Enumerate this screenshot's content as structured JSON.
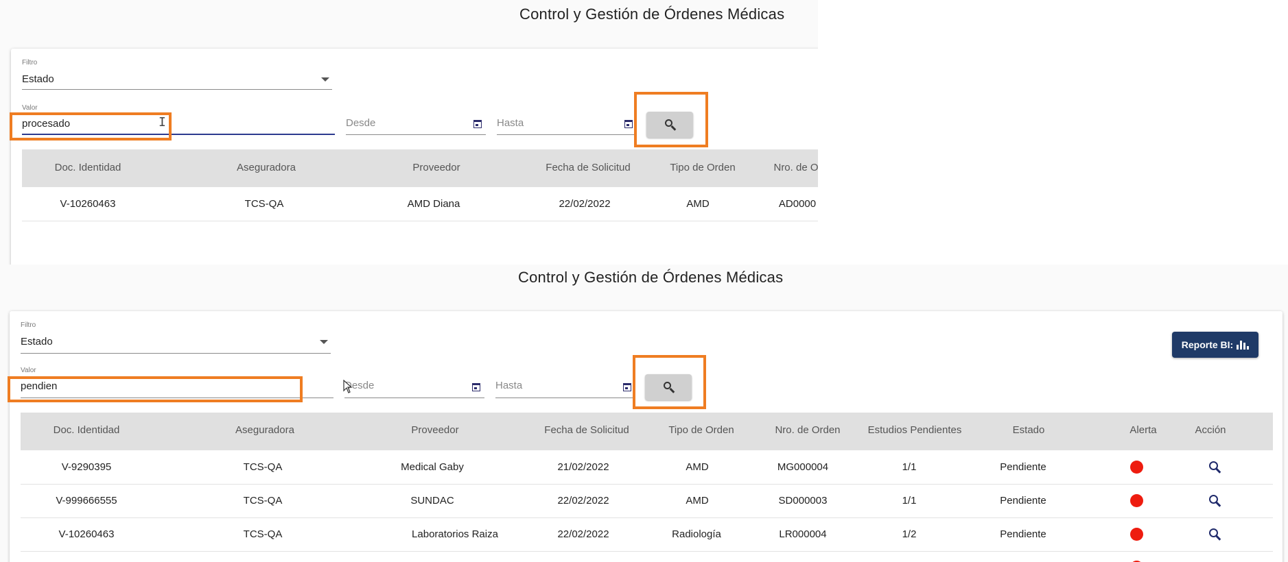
{
  "top": {
    "title": "Control y Gestión de Órdenes Médicas",
    "filter": {
      "label": "Filtro",
      "value": "Estado"
    },
    "value_field": {
      "label": "Valor",
      "value": "procesado"
    },
    "desde": {
      "placeholder": "Desde"
    },
    "hasta": {
      "placeholder": "Hasta"
    },
    "table": {
      "headers": [
        "Doc. Identidad",
        "Aseguradora",
        "Proveedor",
        "Fecha de Solicitud",
        "Tipo de Orden",
        "Nro. de O"
      ],
      "rows": [
        [
          "V-10260463",
          "TCS-QA",
          "AMD Diana",
          "22/02/2022",
          "AMD",
          "AD0000"
        ]
      ]
    }
  },
  "bottom": {
    "title": "Control y Gestión de Órdenes Médicas",
    "filter": {
      "label": "Filtro",
      "value": "Estado"
    },
    "value_field": {
      "label": "Valor",
      "value": "pendien"
    },
    "desde": {
      "placeholder": "Desde"
    },
    "hasta": {
      "placeholder": "Hasta"
    },
    "report_button": {
      "label": "Reporte BI:",
      "icon": "bar-chart-icon"
    },
    "table": {
      "headers": [
        "Doc. Identidad",
        "Aseguradora",
        "Proveedor",
        "Fecha de Solicitud",
        "Tipo de Orden",
        "Nro. de Orden",
        "Estudios Pendientes",
        "Estado",
        "Alerta",
        "Acción"
      ],
      "rows": [
        [
          "V-9290395",
          "TCS-QA",
          "Medical Gaby",
          "21/02/2022",
          "AMD",
          "MG000004",
          "1/1",
          "Pendiente"
        ],
        [
          "V-999666555",
          "TCS-QA",
          "SUNDAC",
          "22/02/2022",
          "AMD",
          "SD000003",
          "1/1",
          "Pendiente"
        ],
        [
          "V-10260463",
          "TCS-QA",
          "Laboratorios Raiza",
          "22/02/2022",
          "Radiología",
          "LR000004",
          "1/2",
          "Pendiente"
        ]
      ]
    }
  },
  "colors": {
    "highlight": "#ef7d22",
    "alert": "#ee1c0f",
    "primary": "#1f3a67",
    "header_bg": "#e0e0e0"
  }
}
